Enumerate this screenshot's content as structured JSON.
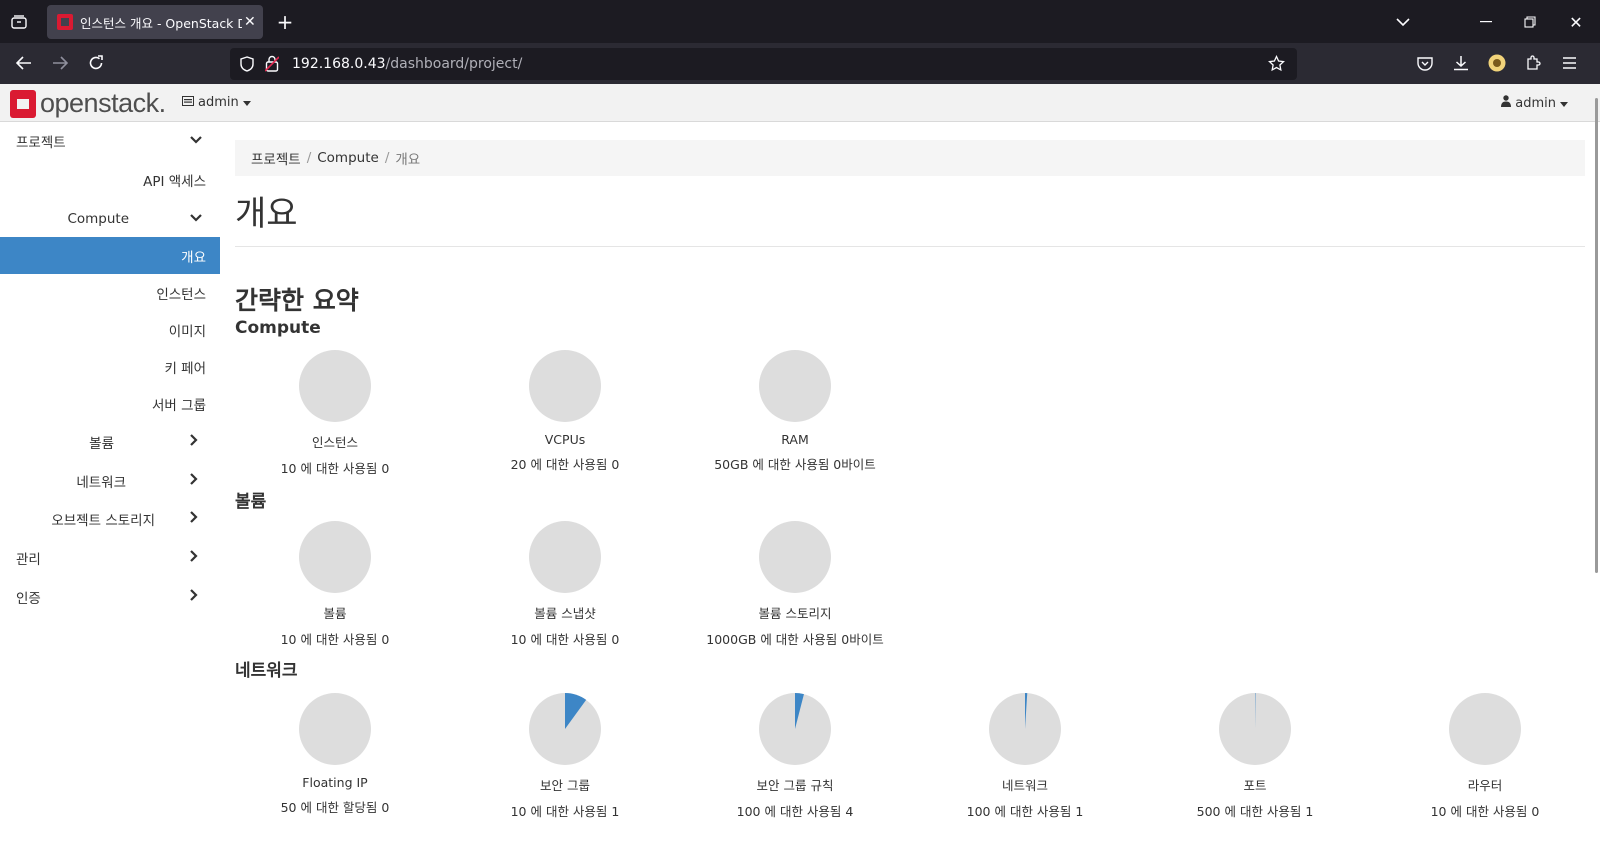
{
  "browser": {
    "tab_title": "인스턴스 개요 - OpenStack Dashboard",
    "url_host": "192.168.0.43",
    "url_path": "/dashboard/project/"
  },
  "header": {
    "logo_text": "openstack.",
    "project_label": "admin",
    "user_label": "admin"
  },
  "sidebar": {
    "items": [
      {
        "label": "프로젝트"
      },
      {
        "label": "API 액세스"
      },
      {
        "label": "Compute"
      },
      {
        "label": "개요"
      },
      {
        "label": "인스턴스"
      },
      {
        "label": "이미지"
      },
      {
        "label": "키 페어"
      },
      {
        "label": "서버 그룹"
      },
      {
        "label": "볼륨"
      },
      {
        "label": "네트워크"
      },
      {
        "label": "오브젝트 스토리지"
      },
      {
        "label": "관리"
      },
      {
        "label": "인증"
      }
    ]
  },
  "breadcrumb": [
    "프로젝트",
    "Compute",
    "개요"
  ],
  "page_title": "개요",
  "summary_heading": "간략한 요약",
  "sections": [
    {
      "heading": "Compute",
      "charts": [
        {
          "title": "인스턴스",
          "sub": "10 에 대한 사용됨 0",
          "used": 0,
          "limit": 10
        },
        {
          "title": "VCPUs",
          "sub": "20 에 대한 사용됨 0",
          "used": 0,
          "limit": 20
        },
        {
          "title": "RAM",
          "sub": "50GB 에 대한 사용됨 0바이트",
          "used": 0,
          "limit": 50
        }
      ]
    },
    {
      "heading": "볼륨",
      "charts": [
        {
          "title": "볼륨",
          "sub": "10 에 대한 사용됨 0",
          "used": 0,
          "limit": 10
        },
        {
          "title": "볼륨 스냅샷",
          "sub": "10 에 대한 사용됨 0",
          "used": 0,
          "limit": 10
        },
        {
          "title": "볼륨 스토리지",
          "sub": "1000GB 에 대한 사용됨 0바이트",
          "used": 0,
          "limit": 1000
        }
      ]
    },
    {
      "heading": "네트워크",
      "charts": [
        {
          "title": "Floating IP",
          "sub": "50 에 대한 할당됨 0",
          "used": 0,
          "limit": 50
        },
        {
          "title": "보안 그룹",
          "sub": "10 에 대한 사용됨 1",
          "used": 1,
          "limit": 10
        },
        {
          "title": "보안 그룹 규칙",
          "sub": "100 에 대한 사용됨 4",
          "used": 4,
          "limit": 100
        },
        {
          "title": "네트워크",
          "sub": "100 에 대한 사용됨 1",
          "used": 1,
          "limit": 100
        },
        {
          "title": "포트",
          "sub": "500 에 대한 사용됨 1",
          "used": 1,
          "limit": 500
        },
        {
          "title": "라우터",
          "sub": "10 에 대한 사용됨 0",
          "used": 0,
          "limit": 10
        }
      ]
    }
  ],
  "colors": {
    "pie_bg": "#dddddd",
    "pie_used": "#3d86c6",
    "active_nav": "#3d86c6"
  }
}
